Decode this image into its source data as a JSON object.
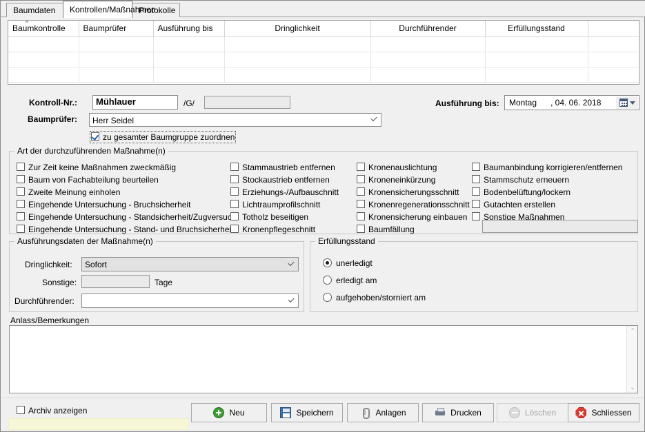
{
  "tabs": [
    {
      "label": "Baumdaten",
      "active": false
    },
    {
      "label": "Kontrollen/Maßnahmen",
      "active": true
    },
    {
      "label": "Protokolle",
      "active": false
    }
  ],
  "grid": {
    "columns": [
      "Baumkontrolle",
      "Baumprüfer",
      "Ausführung bis",
      "Dringlichkeit",
      "Durchführender",
      "Erfüllungsstand",
      ""
    ],
    "sort_indicator": "^",
    "sort_column": "Baumkontrolle",
    "rows": []
  },
  "form": {
    "kontroll_nr_label": "Kontroll-Nr.:",
    "kontroll_nr_value": "Mühlauer",
    "separator_label": "/G/",
    "kontroll_nr_suffix_value": "",
    "baumpruefer_label": "Baumprüfer:",
    "baumpruefer_value": "Herr Seidel",
    "gruppe_checkbox_label": "zu gesamter Baumgruppe zuordnen",
    "gruppe_checkbox_checked": true,
    "ausfuehrung_bis_label": "Ausführung bis:",
    "ausfuehrung_bis_day": "Montag",
    "ausfuehrung_bis_date": ", 04. 06. 2018"
  },
  "massnahmen": {
    "caption": "Art der durchzuführenden Maßnahme(n)",
    "col1": [
      "Zur Zeit keine Maßnahmen zweckmäßig",
      "Baum von Fachabteilung beurteilen",
      "Zweite Meinung einholen",
      "Eingehende Untersuchung - Bruchsicherheit",
      "Eingehende Untersuchung - Standsicherheit/Zugversuch",
      "Eingehende Untersuchung - Stand- und Bruchsicherheit"
    ],
    "col2": [
      "Stammaustrieb entfernen",
      "Stockaustrieb entfernen",
      "Erziehungs-/Aufbauschnitt",
      "Lichtraumprofilschnitt",
      "Totholz beseitigen",
      "Kronenpflegeschnitt"
    ],
    "col3": [
      "Kronenauslichtung",
      "Kroneneinkürzung",
      "Kronensicherungsschnitt",
      "Kronenregenerationsschnitt",
      "Kronensicherung einbauen",
      "Baumfällung"
    ],
    "col4": [
      "Baumanbindung korrigieren/entfernen",
      "Stammschutz erneuern",
      "Bodenbelüftung/lockern",
      "Gutachten erstellen",
      "Sonstige Maßnahmen"
    ],
    "sonstige_value": ""
  },
  "ausfuehrungsdaten": {
    "caption": "Ausführungsdaten der Maßnahme(n)",
    "dringlichkeit_label": "Dringlichkeit:",
    "dringlichkeit_value": "Sofort",
    "sonstige_label": "Sonstige:",
    "sonstige_value": "",
    "tage_label": "Tage",
    "durchfuehrender_label": "Durchführender:",
    "durchfuehrender_value": ""
  },
  "erfuellungsstand": {
    "caption": "Erfüllungsstand",
    "options": [
      {
        "label": "unerledigt",
        "selected": true
      },
      {
        "label": "erledigt am",
        "selected": false
      },
      {
        "label": "aufgehoben/storniert am",
        "selected": false
      }
    ]
  },
  "anlass": {
    "label": "Anlass/Bemerkungen",
    "value": "",
    "scroll_up_icon": "⌃",
    "scroll_down_icon": "⌄"
  },
  "footer": {
    "archiv_label": "Archiv anzeigen",
    "archiv_checked": false,
    "status_text": "",
    "buttons": [
      {
        "label": "Neu",
        "icon": "plus-circle-icon",
        "disabled": false
      },
      {
        "label": "Speichern",
        "icon": "save-disk-icon",
        "disabled": false
      },
      {
        "label": "Anlagen",
        "icon": "paperclip-icon",
        "disabled": false
      },
      {
        "label": "Drucken",
        "icon": "printer-icon",
        "disabled": false
      },
      {
        "label": "Löschen",
        "icon": "minus-circle-icon",
        "disabled": true
      },
      {
        "label": "Schliessen",
        "icon": "close-octagon-icon",
        "disabled": false
      }
    ]
  },
  "colors": {
    "window_bg": "#f0f0f0",
    "field_bg": "#ffffff",
    "readonly_bg": "#eaeaea",
    "status_bg": "#f7f7d8",
    "accent_green": "#3d9b35",
    "accent_red": "#d93b30",
    "accent_blue": "#3f6fa8"
  }
}
